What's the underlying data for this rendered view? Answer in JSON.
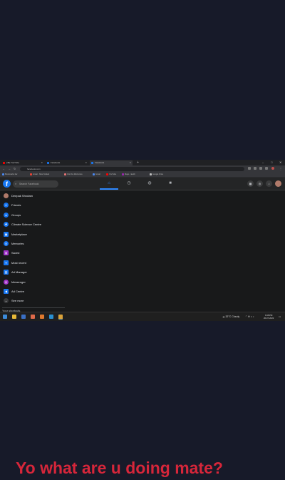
{
  "browser": {
    "tabs": [
      {
        "title": "(48) YouTube",
        "color": "#ff0000"
      },
      {
        "title": "Facebook",
        "color": "#1877f2"
      },
      {
        "title": "Facebook",
        "color": "#1877f2"
      }
    ],
    "url": "facebook.com",
    "bookmarks": [
      {
        "label": "Bookmarks bar",
        "color": "#4a88f0"
      },
      {
        "label": "Gmail · Most Visited",
        "color": "#ea4335"
      },
      {
        "label": "Visit the Web store",
        "color": "#e57373"
      },
      {
        "label": "Gmail",
        "color": "#4a88f0"
      },
      {
        "label": "YouTube",
        "color": "#ff0000"
      },
      {
        "label": "Maps · Earth",
        "color": "#9c27b0"
      },
      {
        "label": "Google Drive",
        "color": "#c0c0c0"
      }
    ]
  },
  "facebook": {
    "logo": "f",
    "search_placeholder": "Search Facebook",
    "sidebar": [
      {
        "label": "Deepak Shrotam",
        "icon": "avatar",
        "color": "#b07a6a"
      },
      {
        "label": "Friends",
        "icon": "friends-icon",
        "color": "#1877f2"
      },
      {
        "label": "Groups",
        "icon": "groups-icon",
        "color": "#1877f2"
      },
      {
        "label": "Climate Science Centre",
        "icon": "climate-icon",
        "color": "#1877f2"
      },
      {
        "label": "Marketplace",
        "icon": "marketplace-icon",
        "color": "#1877f2"
      },
      {
        "label": "Memories",
        "icon": "memories-icon",
        "color": "#1877f2"
      },
      {
        "label": "Saved",
        "icon": "saved-icon",
        "color": "#a033c9"
      },
      {
        "label": "Most recent",
        "icon": "most-recent-icon",
        "color": "#1877f2"
      },
      {
        "label": "Ad Manager",
        "icon": "ad-manager-icon",
        "color": "#1877f2"
      },
      {
        "label": "Messenger",
        "icon": "messenger-icon",
        "color": "#a033c9"
      },
      {
        "label": "Ad Centre",
        "icon": "ad-centre-icon",
        "color": "#1877f2"
      },
      {
        "label": "See more",
        "icon": "chevron-down-icon",
        "color": "#3a3b3c"
      }
    ],
    "shortcuts_heading": "Your shortcuts"
  },
  "taskbar": {
    "weather": "32°C Cloudy",
    "time": "9:48 PM",
    "date": "26-07-2022"
  },
  "caption": "Yo what are u doing mate?"
}
